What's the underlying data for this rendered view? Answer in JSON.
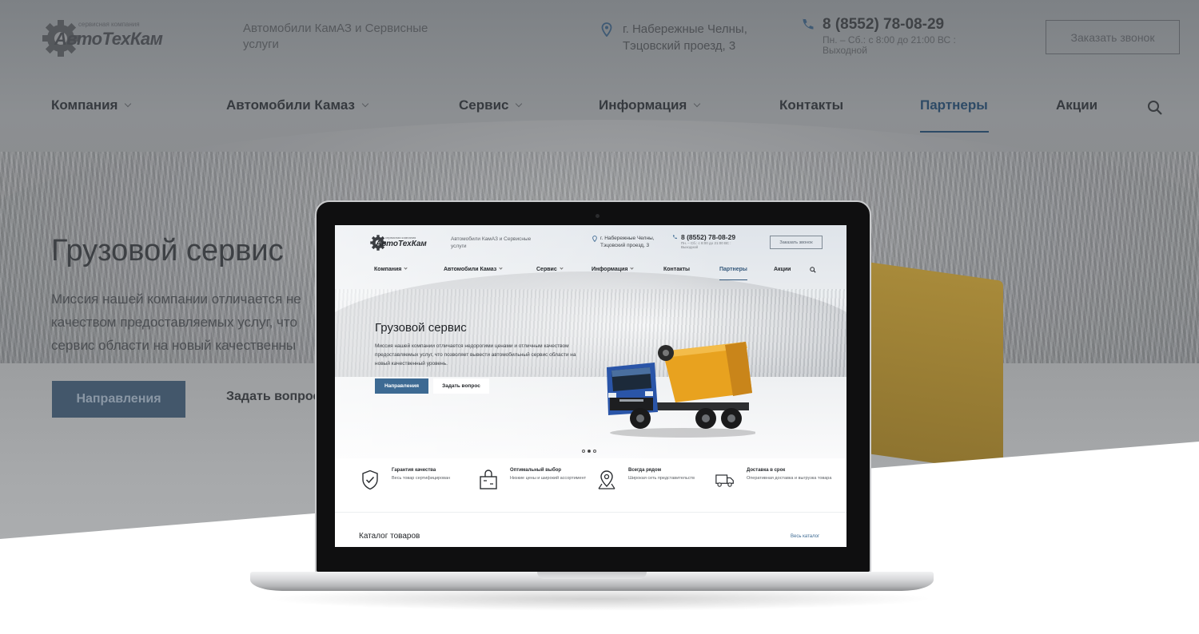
{
  "background": {
    "logo": {
      "sub": "сервисная компания",
      "name": "АвтоТехКам"
    },
    "tagline": "Автомобили КамАЗ и Сервисные услуги",
    "address": {
      "line1": "г. Набережные Челны,",
      "line2": "Тэцовский проезд, 3"
    },
    "phone": {
      "number": "8 (8552) 78-08-29",
      "hours": "Пн. – Сб.: с 8:00 до 21:00 ВС : Выходной"
    },
    "call_button": "Заказать звонок",
    "nav": [
      {
        "label": "Компания",
        "dropdown": true
      },
      {
        "label": "Автомобили Камаз",
        "dropdown": true
      },
      {
        "label": "Сервис",
        "dropdown": true
      },
      {
        "label": "Информация",
        "dropdown": true
      },
      {
        "label": "Контакты",
        "dropdown": false
      },
      {
        "label": "Партнеры",
        "dropdown": false,
        "active": true
      },
      {
        "label": "Акции",
        "dropdown": false
      }
    ],
    "hero": {
      "title": "Грузовой сервис",
      "desc_lines": [
        "Миссия нашей компании отличается не",
        "качеством предоставляемых услуг, что",
        "сервис области на новый качественны"
      ],
      "primary_button": "Направления",
      "secondary_button": "Задать вопрос"
    }
  },
  "screen": {
    "logo": {
      "sub": "сервисная компания",
      "name": "АвтоТехКам"
    },
    "tagline": "Автомобили КамАЗ и Сервисные услуги",
    "address": {
      "line1": "г. Набережные Челны,",
      "line2": "Тэцовский проезд, 3"
    },
    "phone": {
      "number": "8 (8552) 78-08-29",
      "hours": "Пн. – Сб.: с 8:00 до 21:00 ВС : Выходной"
    },
    "call_button": "Заказать звонок",
    "nav": [
      {
        "label": "Компания"
      },
      {
        "label": "Автомобили Камаз"
      },
      {
        "label": "Сервис"
      },
      {
        "label": "Информация"
      },
      {
        "label": "Контакты"
      },
      {
        "label": "Партнеры"
      },
      {
        "label": "Акции"
      }
    ],
    "hero": {
      "title": "Грузовой сервис",
      "desc": "Миссия нашей компании отличается недорогими ценами и отличным качеством предоставляемых услуг, что позволяет вывести автомобильный сервис области на новый качественный уровень.",
      "primary_button": "Направления",
      "secondary_button": "Задать вопрос",
      "slides": 3,
      "active_slide": 2
    },
    "features": [
      {
        "title": "Гарантия качества",
        "desc": "Весь товар сертифицирован",
        "icon": "shield-check-icon"
      },
      {
        "title": "Оптимальный выбор",
        "desc": "Низкие цены и широкий ассортимент",
        "icon": "shopping-bag-icon"
      },
      {
        "title": "Всегда рядом",
        "desc": "Широкая сеть представительств",
        "icon": "map-pin-icon"
      },
      {
        "title": "Доставка в срок",
        "desc": "Оперативная доставка и выгрузка товара",
        "icon": "delivery-truck-icon"
      }
    ],
    "catalog": {
      "title": "Каталог товаров",
      "all_link": "Весь каталог"
    }
  },
  "colors": {
    "accent": "#3d6a93",
    "dark_text": "#25282c",
    "truck_body": "#e8a21f",
    "truck_cab": "#2a55a8"
  }
}
